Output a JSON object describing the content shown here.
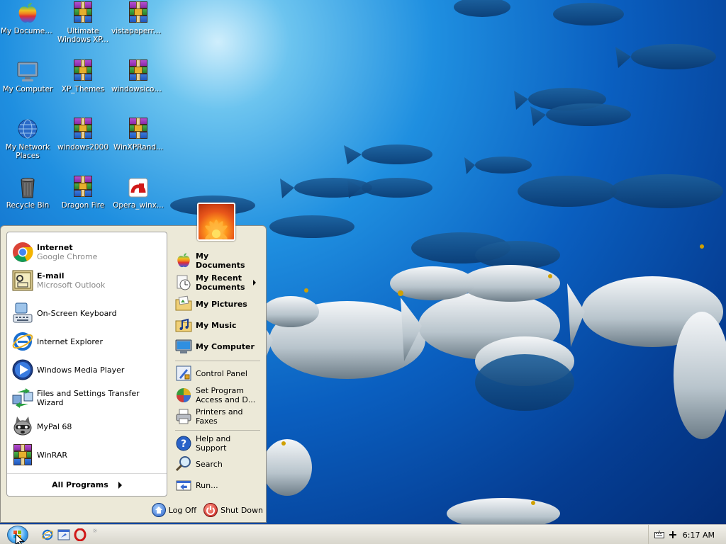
{
  "desktop": {
    "icons": [
      {
        "label": "My Documents",
        "icon": "apple-icon"
      },
      {
        "label": "Ultimate Windows XP...",
        "icon": "rar-icon"
      },
      {
        "label": "vistapaperre...",
        "icon": "rar-icon"
      },
      {
        "label": "My Computer",
        "icon": "monitor-icon"
      },
      {
        "label": "XP_Themes",
        "icon": "rar-icon"
      },
      {
        "label": "windowsicon...",
        "icon": "rar-icon"
      },
      {
        "label": "My Network Places",
        "icon": "globe-icon"
      },
      {
        "label": "windows2000",
        "icon": "rar-icon"
      },
      {
        "label": "WinXPRand...",
        "icon": "rar-icon"
      },
      {
        "label": "Recycle Bin",
        "icon": "trash-icon"
      },
      {
        "label": "Dragon Fire",
        "icon": "rar-icon"
      },
      {
        "label": "Opera_winx...",
        "icon": "opera-file-icon"
      }
    ]
  },
  "start_menu": {
    "pinned": [
      {
        "title": "Internet",
        "subtitle": "Google Chrome",
        "icon": "chrome-icon"
      },
      {
        "title": "E-mail",
        "subtitle": "Microsoft Outlook",
        "icon": "outlook-icon"
      }
    ],
    "recent": [
      {
        "label": "On-Screen Keyboard",
        "icon": "keyboard-icon"
      },
      {
        "label": "Internet Explorer",
        "icon": "ie-icon"
      },
      {
        "label": "Windows Media Player",
        "icon": "media-player-icon"
      },
      {
        "label": "Files and Settings Transfer Wizard",
        "icon": "transfer-wizard-icon"
      },
      {
        "label": "MyPal 68",
        "icon": "raccoon-icon"
      },
      {
        "label": "WinRAR",
        "icon": "rar-icon"
      }
    ],
    "all_programs": "All Programs",
    "right": {
      "my_documents": "My Documents",
      "my_recent_documents": "My Recent Documents",
      "my_pictures": "My Pictures",
      "my_music": "My Music",
      "my_computer": "My Computer",
      "control_panel": "Control Panel",
      "set_program_access": "Set Program Access and D...",
      "printers_and_faxes": "Printers and Faxes",
      "help_and_support": "Help and Support",
      "search": "Search",
      "run": "Run..."
    },
    "log_off": "Log Off",
    "shut_down": "Shut Down"
  },
  "taskbar": {
    "clock": "6:17 AM",
    "quick_launch_more": "»"
  }
}
